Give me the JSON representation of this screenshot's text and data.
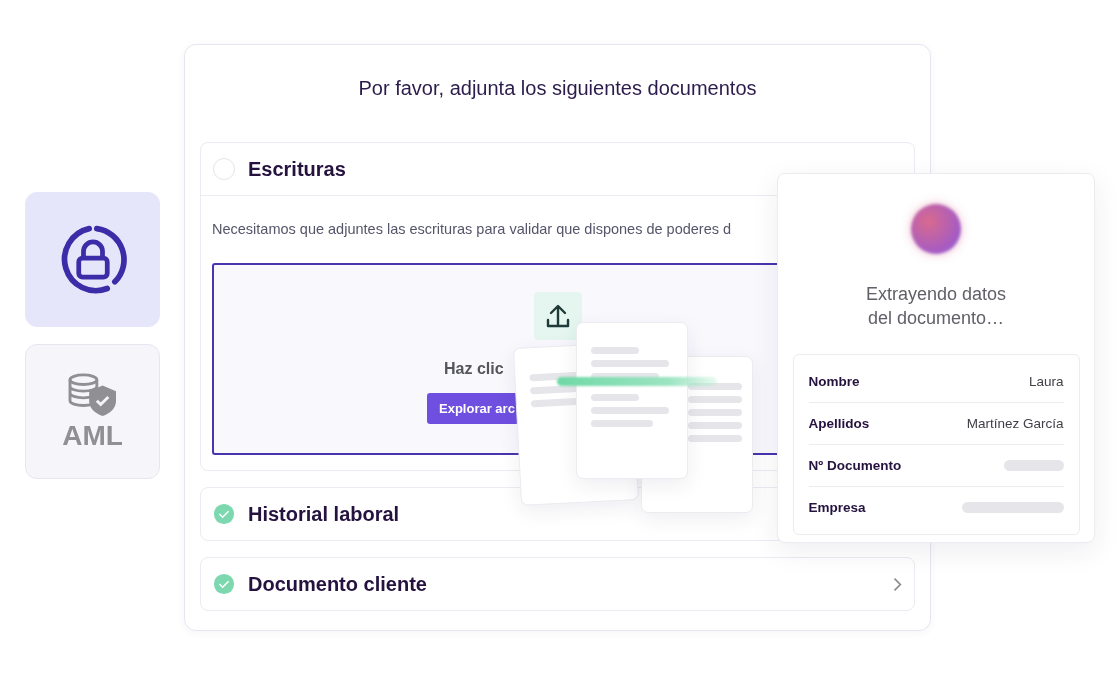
{
  "side_tiles": [
    {
      "kind": "lock",
      "selected": true
    },
    {
      "kind": "aml",
      "label": "AML",
      "selected": false
    }
  ],
  "upload_panel": {
    "title": "Por favor, adjunta los siguientes documentos",
    "documents": [
      {
        "title": "Escrituras",
        "done": false,
        "expanded": true,
        "description": "Necesitamos que adjuntes las escrituras para validar que dispones de poderes d",
        "dropzone": {
          "prompt": "Haz clic",
          "button": "Explorar arc"
        }
      },
      {
        "title": "Historial laboral",
        "done": true,
        "expanded": false
      },
      {
        "title": "Documento cliente",
        "done": true,
        "expanded": false
      }
    ]
  },
  "extraction_card": {
    "status": "Extrayendo datos\ndel documento…",
    "fields": [
      {
        "label": "Nombre",
        "value": "Laura",
        "pending": false
      },
      {
        "label": "Apellidos",
        "value": "Martínez García",
        "pending": false
      },
      {
        "label": "Nº Documento",
        "pending": true
      },
      {
        "label": "Empresa",
        "pending": true
      }
    ]
  }
}
